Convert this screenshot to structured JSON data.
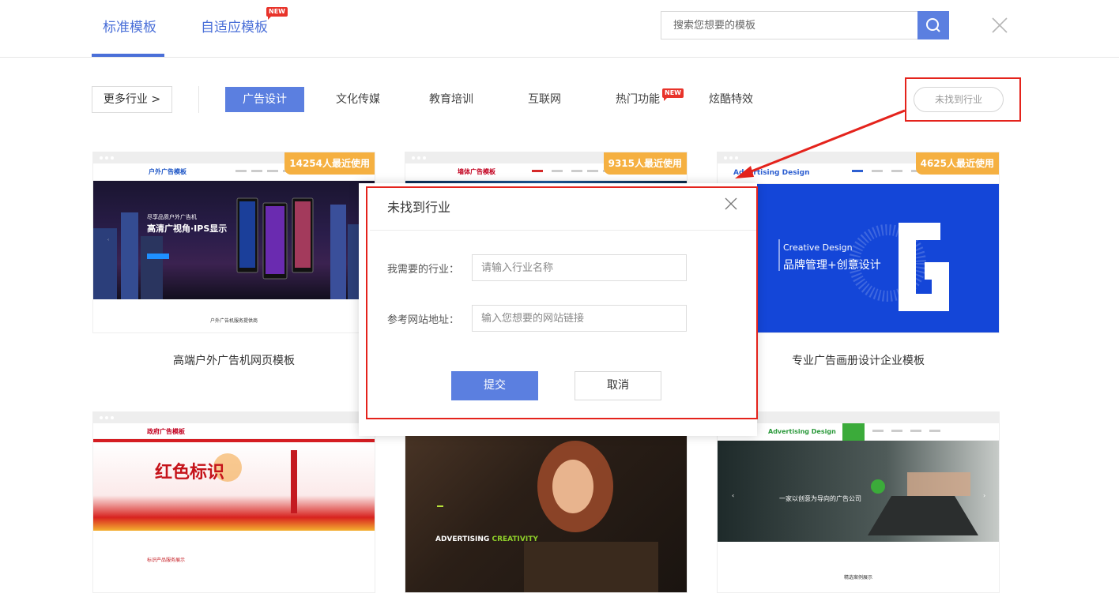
{
  "header": {
    "tabs": [
      {
        "label": "标准模板",
        "active": true
      },
      {
        "label": "自适应模板",
        "badge": "NEW"
      }
    ],
    "search": {
      "placeholder": "搜索您想要的模板"
    }
  },
  "filters": {
    "more_label": "更多行业 >",
    "categories": [
      {
        "label": "广告设计",
        "active": true
      },
      {
        "label": "文化传媒"
      },
      {
        "label": "教育培训"
      },
      {
        "label": "互联网"
      },
      {
        "label": "热门功能",
        "badge": "NEW"
      },
      {
        "label": "炫酷特效"
      }
    ],
    "not_found_label": "未找到行业"
  },
  "cards": [
    {
      "title": "高端户外广告机网页模板",
      "usage": "14254人最近使用",
      "preview": {
        "logo": "户外广告模板",
        "hero_small": "尽享品质户外广告机",
        "hero_big": "高清广视角·IPS显示",
        "section": "户外广告机服务提供商"
      }
    },
    {
      "title": "",
      "usage": "9315人最近使用",
      "preview": {
        "logo": "墙体广告模板"
      }
    },
    {
      "title": "专业广告画册设计企业模板",
      "usage": "4625人最近使用",
      "preview": {
        "logo": "Advertising Design",
        "hero_en": "Creative Design",
        "hero_cn": "品牌管理+创意设计"
      }
    },
    {
      "title": "",
      "preview": {
        "logo": "政府广告模板",
        "hero_big": "红色标识",
        "section": "标识产品服务展示"
      }
    },
    {
      "title": "",
      "preview": {
        "hero_en": "ADVERTISING",
        "hero_accent": "CREATIVITY"
      }
    },
    {
      "title": "",
      "preview": {
        "logo": "Advertising Design",
        "hero_cn": "一家以创意为导向的广告公司",
        "section": "精选案例展示"
      }
    }
  ],
  "modal": {
    "title": "未找到行业",
    "industry_label": "我需要的行业：",
    "industry_placeholder": "请输入行业名称",
    "url_label": "参考网站地址：",
    "url_placeholder": "输入您想要的网站链接",
    "submit_label": "提交",
    "cancel_label": "取消"
  },
  "colors": {
    "accent": "#5b7fe0",
    "highlight": "#e4231c",
    "badge": "#f5b041"
  },
  "icons": [
    "search-icon",
    "close-icon",
    "arrow-annotation"
  ]
}
